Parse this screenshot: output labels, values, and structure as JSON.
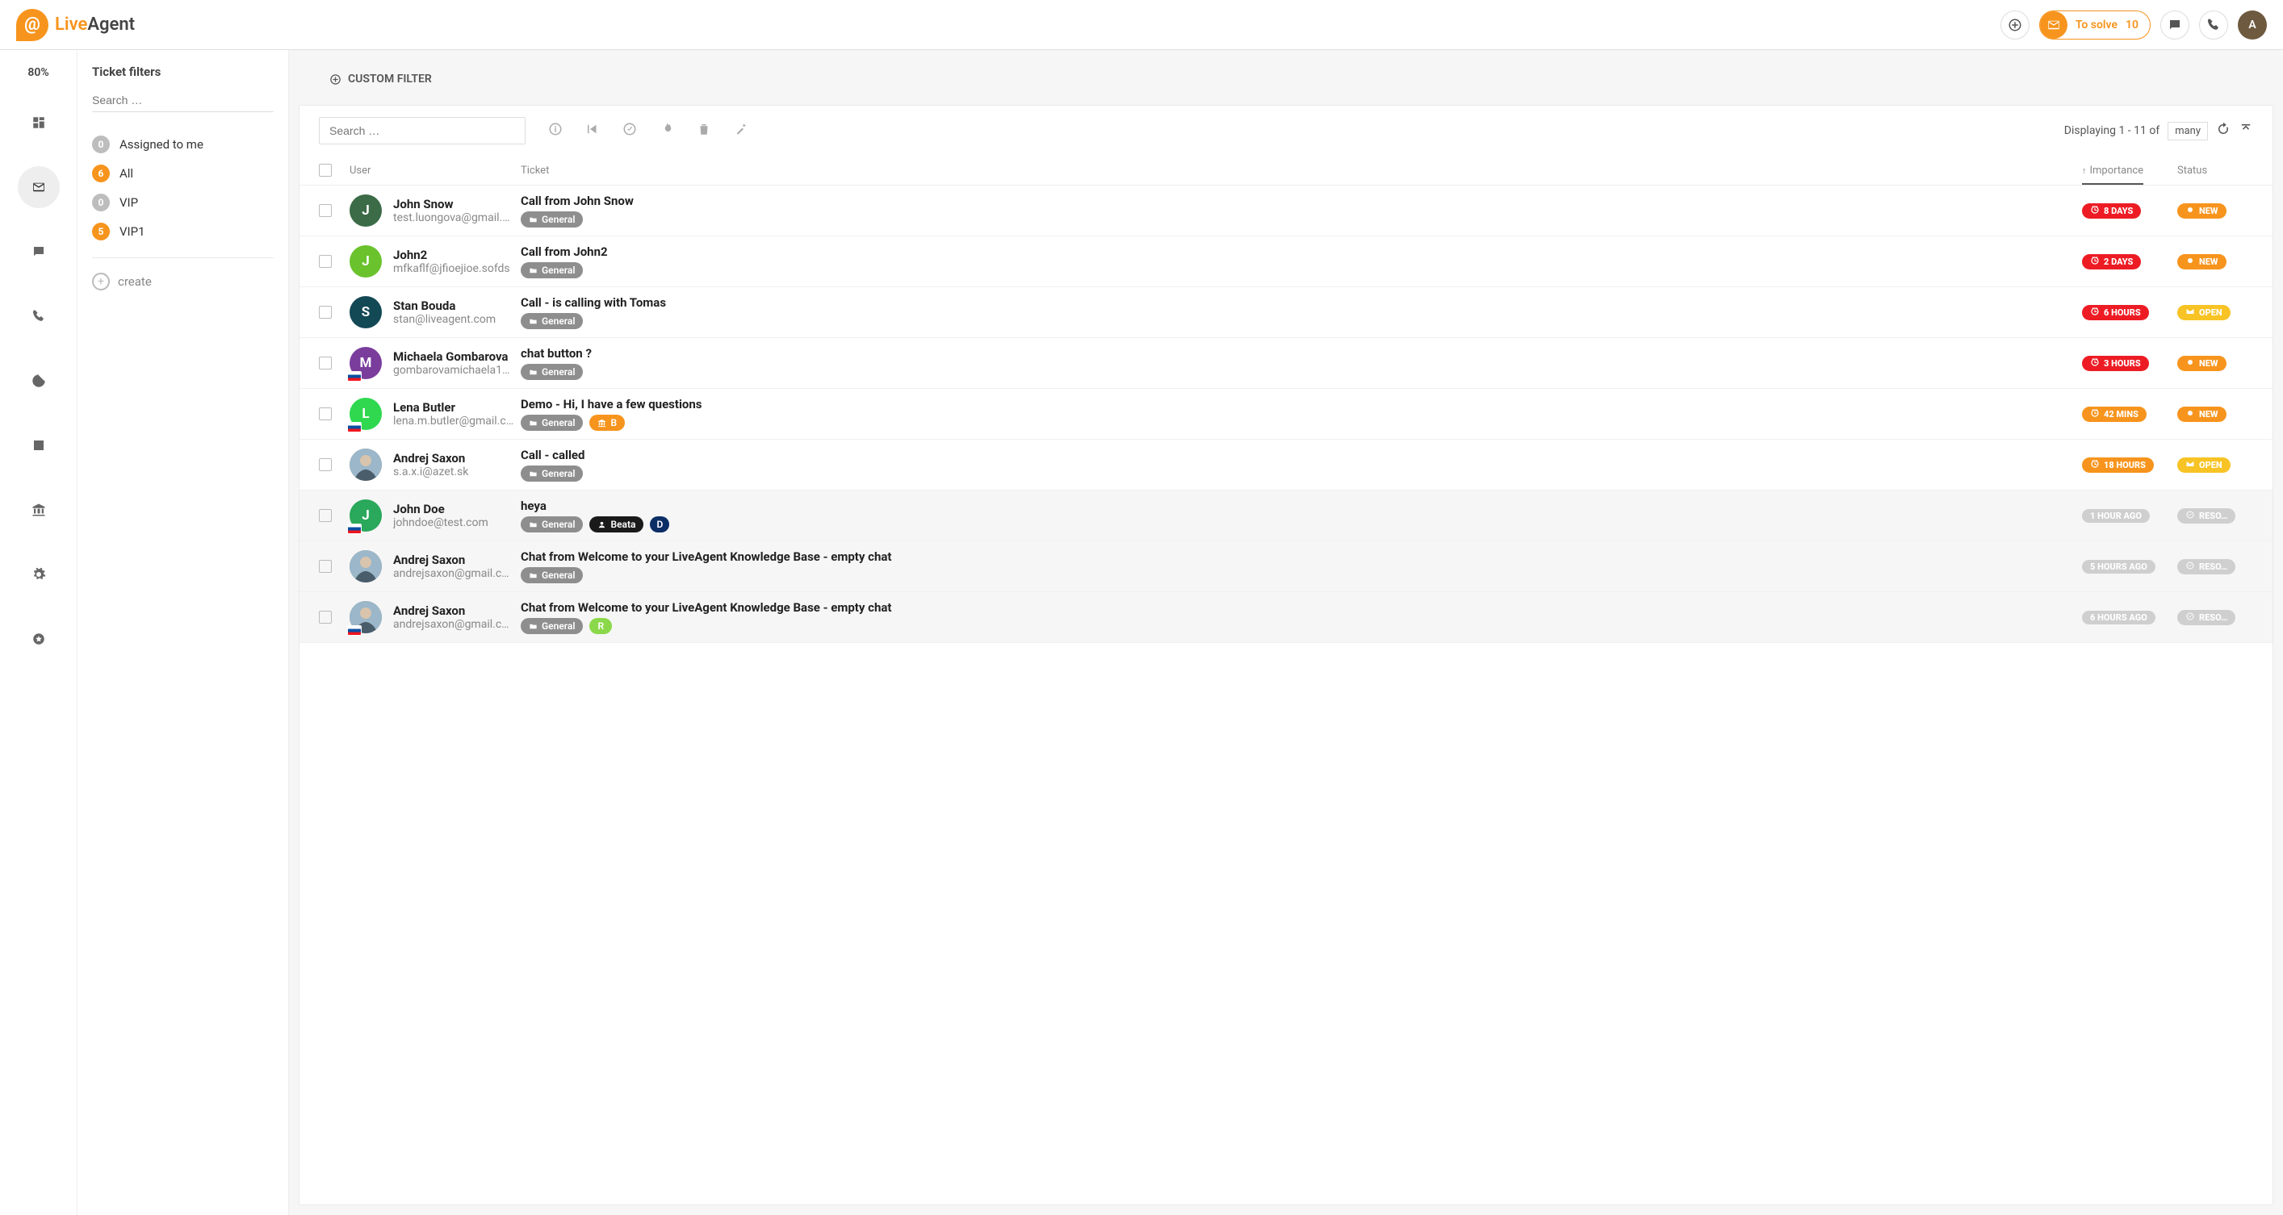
{
  "brand": {
    "name_a": "Live",
    "name_b": "Agent"
  },
  "header": {
    "to_solve_label": "To solve",
    "to_solve_count": "10",
    "avatar_initial": "A"
  },
  "rail": {
    "percent": "80%"
  },
  "filter_panel": {
    "title": "Ticket filters",
    "search_placeholder": "Search …",
    "items": [
      {
        "count": "0",
        "color": "gray",
        "label": "Assigned to me"
      },
      {
        "count": "6",
        "color": "orange",
        "label": "All"
      },
      {
        "count": "0",
        "color": "gray",
        "label": "VIP"
      },
      {
        "count": "5",
        "color": "orange",
        "label": "VIP1"
      }
    ],
    "create_label": "create"
  },
  "custom_filter_label": "CUSTOM FILTER",
  "toolbar": {
    "search_placeholder": "Search …",
    "displaying_text": "Displaying 1 - 11 of",
    "ddl_value": "many"
  },
  "columns": {
    "user": "User",
    "ticket": "Ticket",
    "importance": "Importance",
    "status": "Status"
  },
  "rows": [
    {
      "initial": "J",
      "avatar_bg": "#3c6b47",
      "flag": false,
      "name": "John Snow",
      "email": "test.luongova@gmail.…",
      "subject": "Call from John Snow",
      "tags": [
        {
          "kind": "general",
          "text": "General"
        }
      ],
      "importance": {
        "cls": "red",
        "icon": "clock",
        "text": "8 DAYS"
      },
      "status": {
        "cls": "orange",
        "icon": "dot",
        "text": "NEW"
      },
      "muted": false
    },
    {
      "initial": "J",
      "avatar_bg": "#6ac22d",
      "flag": false,
      "name": "John2",
      "email": "mfkaflf@jfioejioe.sofds",
      "subject": "Call from John2",
      "tags": [
        {
          "kind": "general",
          "text": "General"
        }
      ],
      "importance": {
        "cls": "red",
        "icon": "clock",
        "text": "2 DAYS"
      },
      "status": {
        "cls": "orange",
        "icon": "dot",
        "text": "NEW"
      },
      "muted": false
    },
    {
      "initial": "S",
      "avatar_bg": "#134855",
      "flag": false,
      "name": "Stan Bouda",
      "email": "stan@liveagent.com",
      "subject": "Call - is calling with Tomas",
      "tags": [
        {
          "kind": "general",
          "text": "General"
        }
      ],
      "importance": {
        "cls": "red",
        "icon": "clock",
        "text": "6 HOURS"
      },
      "status": {
        "cls": "yellow",
        "icon": "mail",
        "text": "OPEN"
      },
      "muted": false
    },
    {
      "initial": "M",
      "avatar_bg": "#7a3d9c",
      "flag": true,
      "name": "Michaela Gombarova",
      "email": "gombarovamichaela1…",
      "subject": "chat button ?",
      "tags": [
        {
          "kind": "general",
          "text": "General"
        }
      ],
      "importance": {
        "cls": "red",
        "icon": "clock",
        "text": "3 HOURS"
      },
      "status": {
        "cls": "orange",
        "icon": "dot",
        "text": "NEW"
      },
      "muted": false
    },
    {
      "initial": "L",
      "avatar_bg": "#2fd84f",
      "flag": true,
      "name": "Lena Butler",
      "email": "lena.m.butler@gmail.c…",
      "subject": "Demo - Hi, I have a few questions",
      "tags": [
        {
          "kind": "general",
          "text": "General"
        },
        {
          "kind": "orange",
          "text": "B",
          "icon": "bank"
        }
      ],
      "importance": {
        "cls": "orange",
        "icon": "clock",
        "text": "42 MINS"
      },
      "status": {
        "cls": "orange",
        "icon": "dot",
        "text": "NEW"
      },
      "muted": false
    },
    {
      "initial": "",
      "avatar_bg": "#888",
      "flag": false,
      "photo": true,
      "name": "Andrej Saxon",
      "email": "s.a.x.i@azet.sk",
      "subject": "Call - called",
      "tags": [
        {
          "kind": "general",
          "text": "General"
        }
      ],
      "importance": {
        "cls": "orange",
        "icon": "clock",
        "text": "18 HOURS"
      },
      "status": {
        "cls": "yellow",
        "icon": "mail",
        "text": "OPEN"
      },
      "muted": false
    },
    {
      "initial": "J",
      "avatar_bg": "#2aa85b",
      "flag": true,
      "name": "John Doe",
      "email": "johndoe@test.com",
      "subject": "heya",
      "tags": [
        {
          "kind": "general",
          "text": "General"
        },
        {
          "kind": "dark",
          "text": "Beata",
          "icon": "user"
        },
        {
          "kind": "navy",
          "text": "D"
        }
      ],
      "importance": {
        "cls": "gray",
        "icon": "",
        "text": "1 HOUR AGO"
      },
      "status": {
        "cls": "gray",
        "icon": "check",
        "text": "RESO…"
      },
      "muted": true
    },
    {
      "initial": "",
      "avatar_bg": "#888",
      "flag": false,
      "photo": true,
      "name": "Andrej Saxon",
      "email": "andrejsaxon@gmail.c…",
      "subject": "Chat from Welcome to your LiveAgent Knowledge Base - empty chat",
      "tags": [
        {
          "kind": "general",
          "text": "General"
        }
      ],
      "importance": {
        "cls": "gray",
        "icon": "",
        "text": "5 HOURS AGO"
      },
      "status": {
        "cls": "gray",
        "icon": "check",
        "text": "RESO…"
      },
      "muted": true
    },
    {
      "initial": "",
      "avatar_bg": "#888",
      "flag": true,
      "photo": true,
      "name": "Andrej Saxon",
      "email": "andrejsaxon@gmail.c…",
      "subject": "Chat from Welcome to your LiveAgent Knowledge Base - empty chat",
      "tags": [
        {
          "kind": "general",
          "text": "General"
        },
        {
          "kind": "green",
          "text": "R"
        }
      ],
      "importance": {
        "cls": "gray",
        "icon": "",
        "text": "6 HOURS AGO"
      },
      "status": {
        "cls": "gray",
        "icon": "check",
        "text": "RESO…"
      },
      "muted": true
    }
  ]
}
